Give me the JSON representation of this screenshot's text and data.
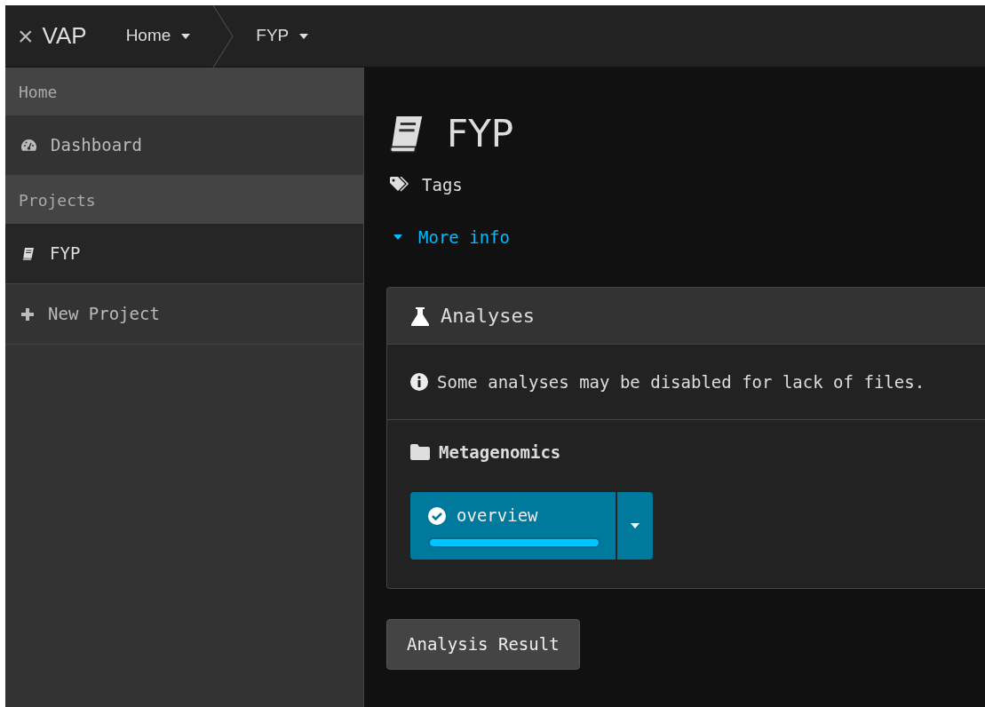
{
  "topbar": {
    "close": "×",
    "brand": "VAP",
    "breadcrumbs": [
      {
        "label": "Home"
      },
      {
        "label": "FYP"
      }
    ]
  },
  "sidebar": {
    "items": [
      {
        "kind": "header",
        "label": "Home",
        "selected": false
      },
      {
        "kind": "dashboard",
        "label": "Dashboard",
        "selected": false
      },
      {
        "kind": "header",
        "label": "Projects",
        "selected": false
      },
      {
        "kind": "project",
        "label": "FYP",
        "selected": true
      },
      {
        "kind": "action",
        "label": "New Project",
        "selected": false
      }
    ]
  },
  "project": {
    "title": "FYP",
    "tags": "Tags",
    "more_info": "More info",
    "expanded": false
  },
  "analyses": {
    "title": "Analyses",
    "notice": "Some analyses may be disabled for lack of files.",
    "groups": [
      {
        "name": "Metagenomics",
        "items": [
          {
            "label": "overview",
            "done": true,
            "level": 1
          }
        ]
      }
    ]
  },
  "result_button": "Analysis Result"
}
